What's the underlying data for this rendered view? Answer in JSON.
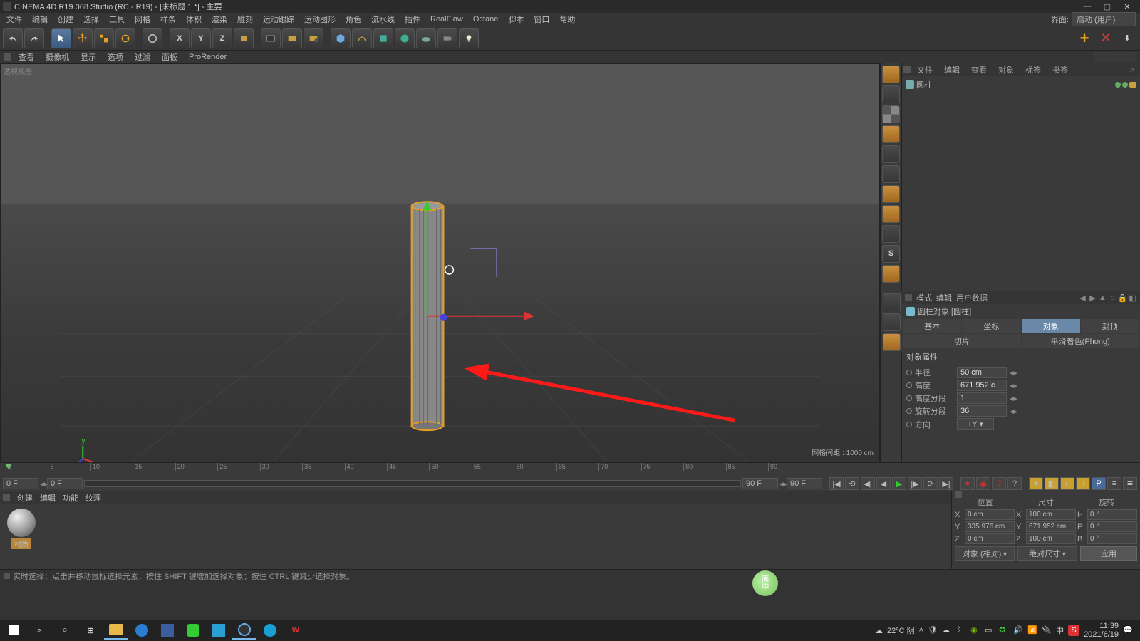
{
  "titlebar": {
    "title": "CINEMA 4D R19.068 Studio (RC - R19) - [未标题 1 *] - 主要"
  },
  "menubar": {
    "items": [
      "文件",
      "编辑",
      "创建",
      "选择",
      "工具",
      "网格",
      "样条",
      "体积",
      "渲染",
      "雕刻",
      "运动跟踪",
      "运动图形",
      "角色",
      "流水线",
      "插件",
      "RealFlow",
      "Octane",
      "脚本",
      "窗口",
      "帮助"
    ],
    "layout_label": "界面:",
    "layout_value": "启动 (用户)"
  },
  "vpmenu": {
    "items": [
      "查看",
      "摄像机",
      "显示",
      "选项",
      "过滤",
      "面板",
      "ProRender"
    ]
  },
  "viewport": {
    "label": "透视视图",
    "grid_info": "网格间距 : 1000 cm"
  },
  "object_panel": {
    "tabs": [
      "文件",
      "编辑",
      "查看",
      "对象",
      "标签",
      "书签"
    ],
    "item": {
      "name": "圆柱"
    }
  },
  "attr": {
    "menu": [
      "模式",
      "编辑",
      "用户数据"
    ],
    "object_title": "圆柱对象 [圆柱]",
    "tabs": [
      "基本",
      "坐标",
      "对象",
      "封顶",
      "切片",
      "平滑着色(Phong)"
    ],
    "active_tab": 2,
    "section": "对象属性",
    "rows": {
      "radius_label": "半径",
      "radius": "50 cm",
      "height_label": "高度",
      "height": "671.952 c",
      "hseg_label": "高度分段",
      "hseg": "1",
      "rseg_label": "旋转分段",
      "rseg": "36",
      "orient_label": "方向",
      "orient": "+Y"
    }
  },
  "timeline": {
    "ticks": [
      "0",
      "5",
      "10",
      "15",
      "20",
      "25",
      "30",
      "35",
      "40",
      "45",
      "50",
      "55",
      "60",
      "65",
      "70",
      "75",
      "80",
      "85",
      "90"
    ],
    "start": "0 F",
    "cur": "0 F",
    "range_end": "90 F",
    "end": "90 F"
  },
  "matmgr": {
    "menu": [
      "创建",
      "编辑",
      "功能",
      "纹理"
    ],
    "material_label": "材质"
  },
  "coords": {
    "headers": [
      "位置",
      "尺寸",
      "旋转"
    ],
    "rows": [
      {
        "axis": "X",
        "pos": "0 cm",
        "size": "100 cm",
        "rot_label": "H",
        "rot": "0 °"
      },
      {
        "axis": "Y",
        "pos": "335.976 cm",
        "size": "671.952 cm",
        "rot_label": "P",
        "rot": "0 °"
      },
      {
        "axis": "Z",
        "pos": "0 cm",
        "size": "100 cm",
        "rot_label": "B",
        "rot": "0 °"
      }
    ],
    "mode1": "对象 (相对)",
    "mode2": "绝对尺寸",
    "apply": "应用"
  },
  "statusbar": {
    "hint": "实时选择：点击并移动鼠标选择元素，按住 SHIFT 键增加选择对象；按住 CTRL 键减少选择对象。"
  },
  "ime": {
    "top": "简",
    "bot": "中"
  },
  "taskbar": {
    "weather": "22°C 阴",
    "time": "11:39",
    "date": "2021/6/19",
    "lang": "中"
  }
}
